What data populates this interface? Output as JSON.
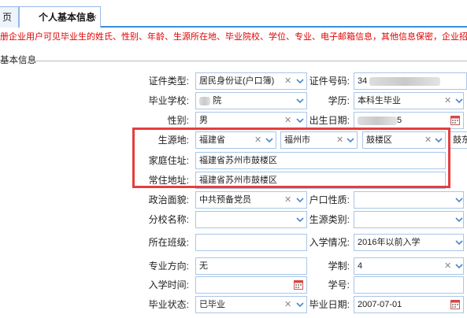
{
  "tabs": {
    "home": "页",
    "active": "个人基本信息",
    "close": "×"
  },
  "notice": "册企业用户可见毕业生的姓氏、性别、年龄、生源所在地、毕业院校、学位、专业、电子邮箱信息，其他信息保密，企业招聘通过",
  "section_title": "基本信息",
  "form": {
    "id_type": {
      "label": "证件类型:",
      "value": "居民身份证(户口簿)"
    },
    "id_number": {
      "label": "证件号码:",
      "value": "34"
    },
    "school": {
      "label": "毕业学校:",
      "value": "院"
    },
    "education": {
      "label": "学历:",
      "value": "本科生毕业"
    },
    "gender": {
      "label": "性别:",
      "value": "男"
    },
    "birth_date": {
      "label": "出生日期:",
      "value": "5"
    },
    "origin": {
      "label": "生源地:",
      "province": "福建省",
      "city": "福州市",
      "district": "鼓楼区",
      "extra": "鼓东"
    },
    "home_address": {
      "label": "家庭住址:",
      "value": "福建省苏州市鼓楼区"
    },
    "residence_address": {
      "label": "常住地址:",
      "value": "福建省苏州市鼓楼区"
    },
    "political_status": {
      "label": "政治面貌:",
      "value": "中共预备党员"
    },
    "household_type": {
      "label": "户口性质:",
      "value": ""
    },
    "branch_school": {
      "label": "分校名称:",
      "value": ""
    },
    "origin_category": {
      "label": "生源类别:",
      "value": ""
    },
    "class": {
      "label": "所在班级:",
      "value": ""
    },
    "enrollment": {
      "label": "入学情况:",
      "value": "2016年以前入学"
    },
    "major_direction": {
      "label": "专业方向:",
      "value": "无"
    },
    "program_length": {
      "label": "学制:",
      "value": "4"
    },
    "enroll_date": {
      "label": "入学时间:",
      "value": ""
    },
    "student_id": {
      "label": "学号:",
      "value": ""
    },
    "grad_status": {
      "label": "毕业状态:",
      "value": "已毕业"
    },
    "grad_date": {
      "label": "毕业日期:",
      "value": "2007-07-01"
    }
  }
}
